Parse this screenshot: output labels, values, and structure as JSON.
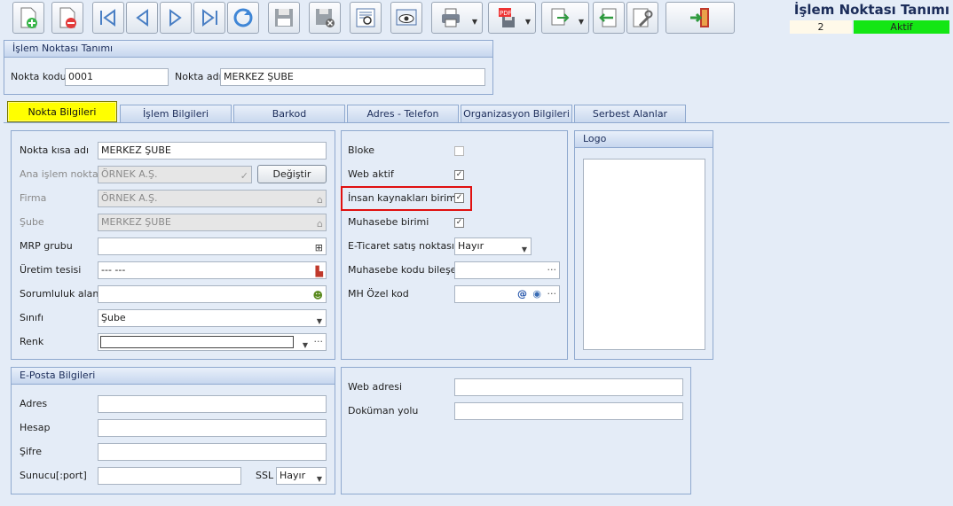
{
  "toolbar": {
    "buttons": [
      "new-record",
      "delete-record",
      "first-record",
      "previous-record",
      "next-record",
      "last-record",
      "refresh",
      "save",
      "save-and-close",
      "preview",
      "view",
      "print",
      "pdf-export",
      "export",
      "back",
      "tools",
      "exit"
    ]
  },
  "header": {
    "title": "İşlem Noktası Tanımı",
    "record_number": "2",
    "status": "Aktif",
    "status_color": "#14e614"
  },
  "definition": {
    "panel_title": "İşlem Noktası Tanımı",
    "code_label": "Nokta kodu",
    "code_value": "0001",
    "name_label": "Nokta adı",
    "name_value": "MERKEZ ŞUBE"
  },
  "tabs": [
    "Nokta Bilgileri",
    "İşlem Bilgileri",
    "Barkod",
    "Adres - Telefon",
    "Organizasyon Bilgileri",
    "Serbest Alanlar"
  ],
  "left": {
    "short_name_label": "Nokta kısa adı",
    "short_name_value": "MERKEZ ŞUBE",
    "main_point_label": "Ana işlem noktası",
    "main_point_value": "ÖRNEK A.Ş.",
    "change_button": "Değiştir",
    "company_label": "Firma",
    "company_value": "ÖRNEK A.Ş.",
    "branch_label": "Şube",
    "branch_value": "MERKEZ ŞUBE",
    "mrp_label": "MRP grubu",
    "mrp_value": "",
    "facility_label": "Üretim tesisi",
    "facility_value": "--- ---",
    "responsibility_label": "Sorumluluk alanı",
    "responsibility_value": "",
    "class_label": "Sınıfı",
    "class_value": "Şube",
    "color_label": "Renk",
    "color_value": ""
  },
  "middle": {
    "block_label": "Bloke",
    "block_checked": false,
    "web_active_label": "Web aktif",
    "web_active_checked": true,
    "hr_unit_label": "İnsan kaynakları birimi",
    "hr_unit_checked": true,
    "accounting_unit_label": "Muhasebe birimi",
    "accounting_unit_checked": true,
    "ecommerce_label": "E-Ticaret satış noktası",
    "ecommerce_value": "Hayır",
    "acc_code_label": "Muhasebe kodu bileşeni",
    "acc_code_value": "",
    "mh_code_label": "MH Özel kod",
    "mh_code_value": ""
  },
  "logo": {
    "panel_title": "Logo"
  },
  "email": {
    "panel_title": "E-Posta Bilgileri",
    "address_label": "Adres",
    "address_value": "",
    "account_label": "Hesap",
    "account_value": "",
    "password_label": "Şifre",
    "password_value": "",
    "server_label": "Sunucu[:port]",
    "server_value": "",
    "ssl_label": "SSL",
    "ssl_value": "Hayır"
  },
  "web": {
    "web_address_label": "Web adresi",
    "web_address_value": "",
    "doc_path_label": "Doküman yolu",
    "doc_path_value": ""
  }
}
